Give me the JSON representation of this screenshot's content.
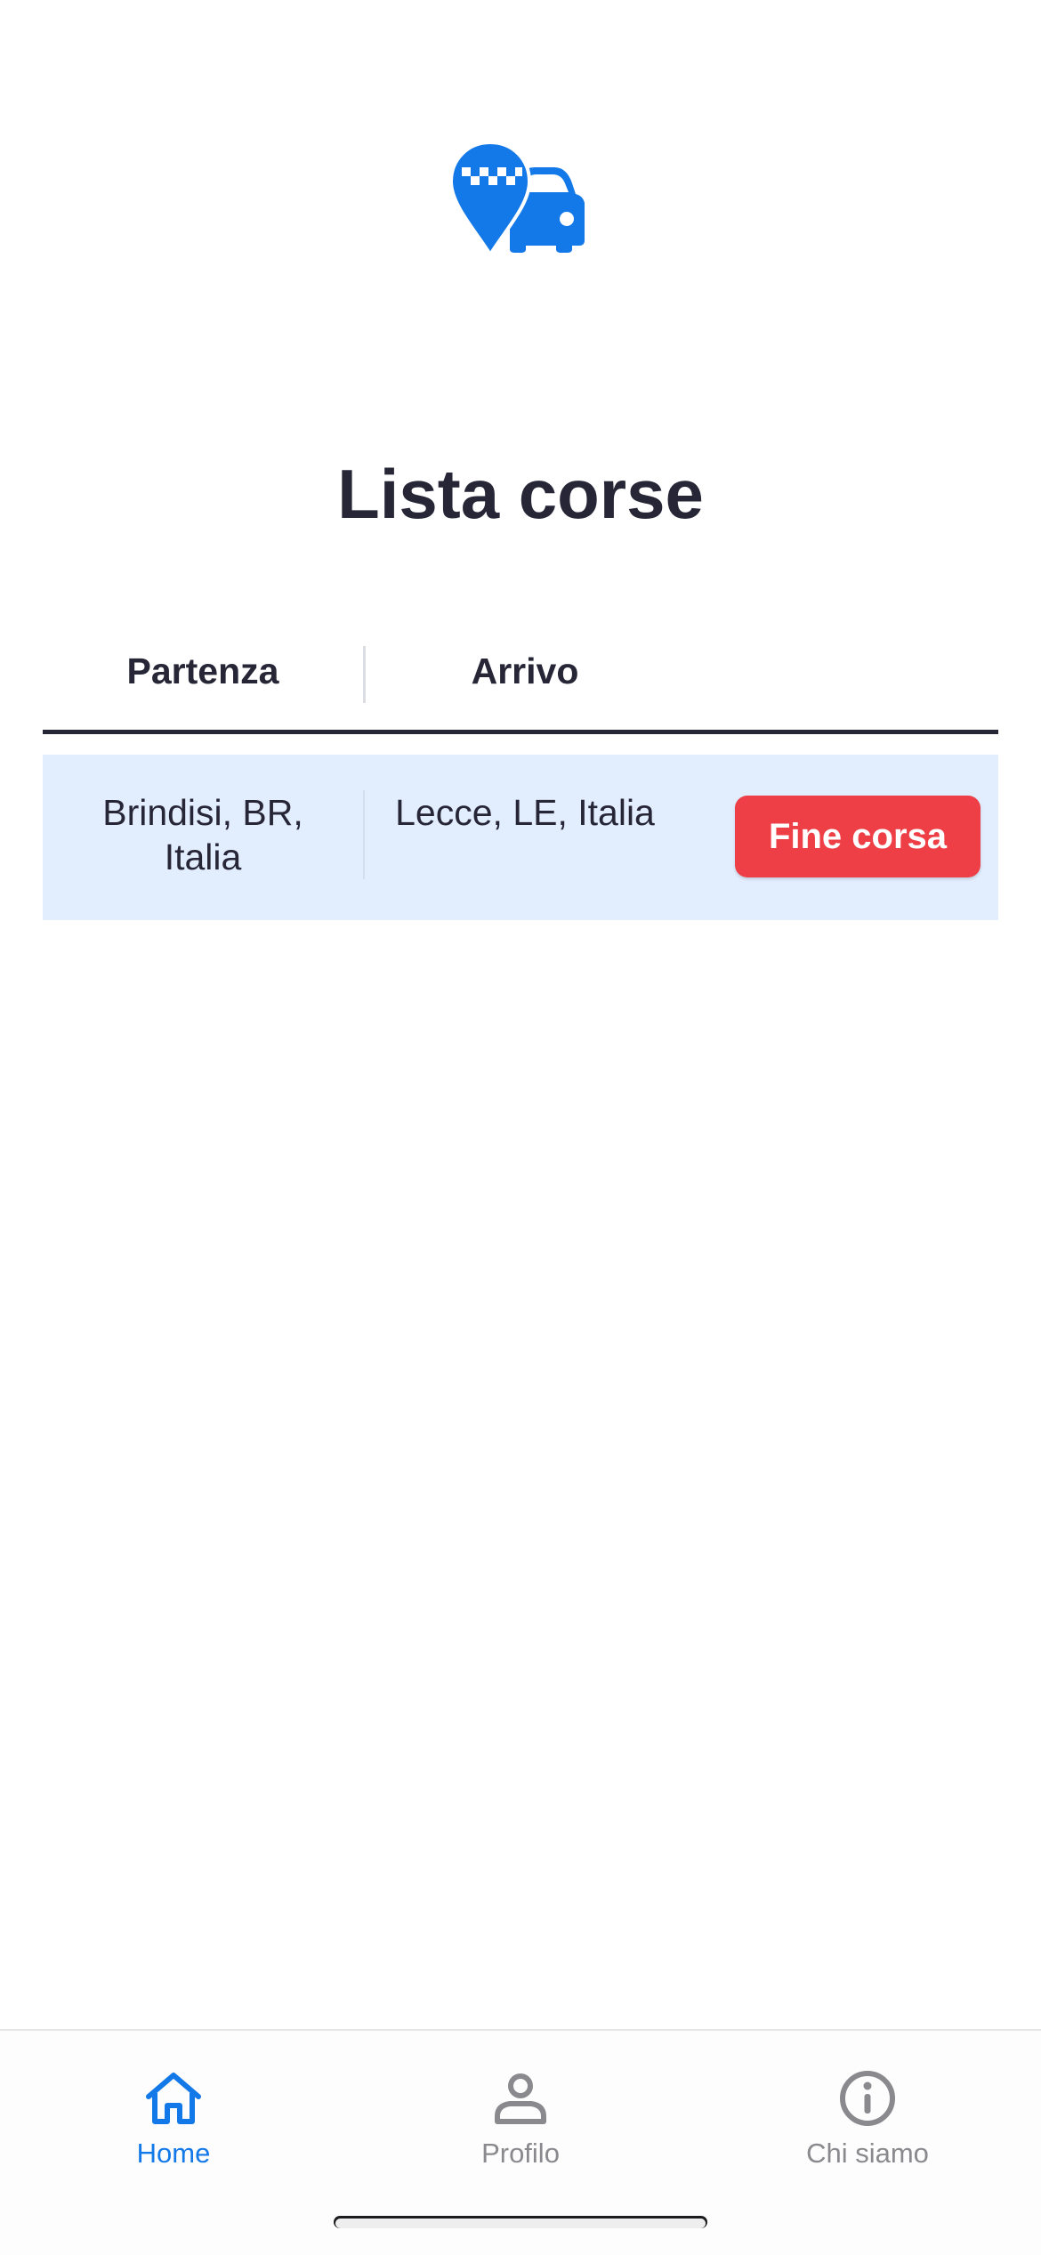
{
  "app": {
    "title": "Lista corse",
    "accent_color": "#1479e8",
    "danger_color": "#ee3f47"
  },
  "logo": {
    "icon": "taxi-location-pin-car-icon"
  },
  "table": {
    "columns": [
      "Partenza",
      "Arrivo"
    ],
    "rows": [
      {
        "partenza": "Brindisi, BR, Italia",
        "arrivo": "Lecce, LE, Italia",
        "action_label": "Fine corsa"
      }
    ]
  },
  "tabbar": {
    "items": [
      {
        "label": "Home",
        "icon": "home-icon",
        "active": true
      },
      {
        "label": "Profilo",
        "icon": "person-icon",
        "active": false
      },
      {
        "label": "Chi siamo",
        "icon": "info-icon",
        "active": false
      }
    ]
  }
}
